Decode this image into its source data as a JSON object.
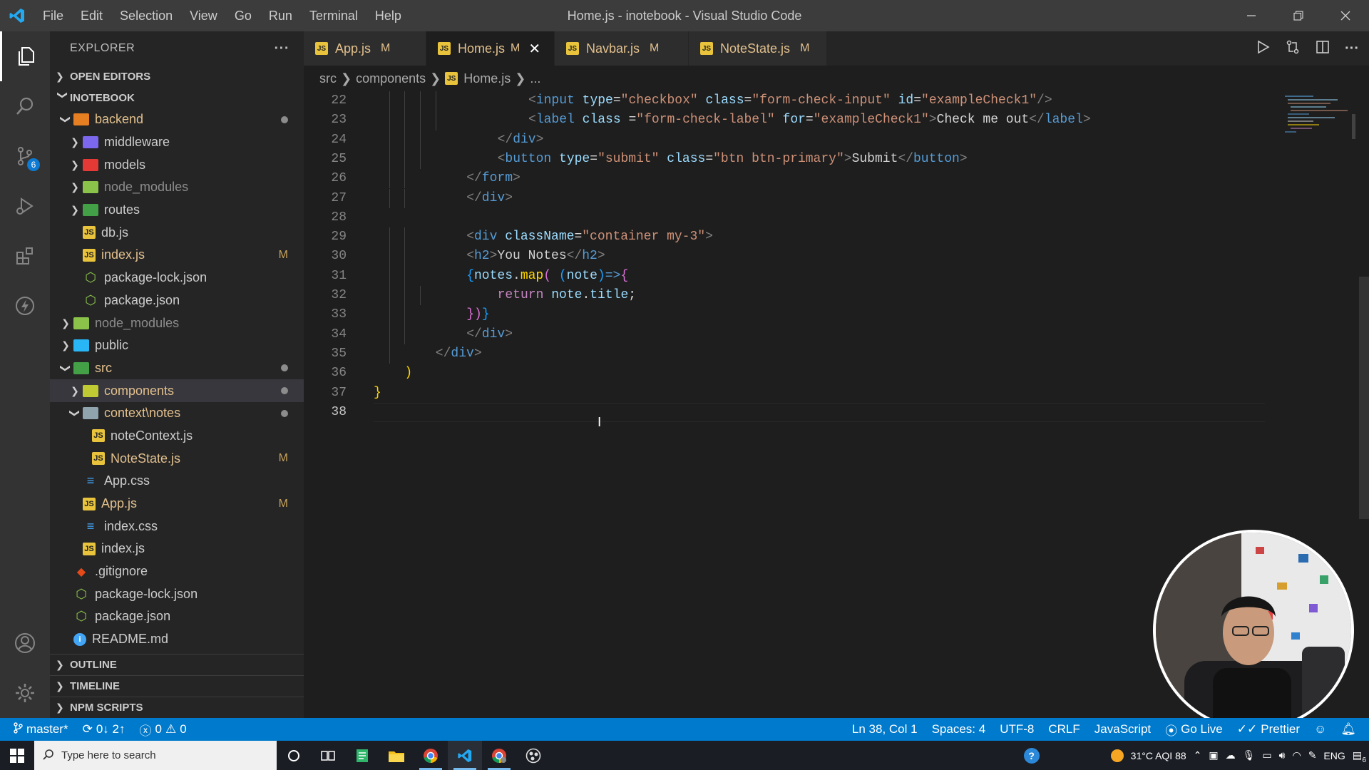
{
  "titlebar": {
    "menu": [
      "File",
      "Edit",
      "Selection",
      "View",
      "Go",
      "Run",
      "Terminal",
      "Help"
    ],
    "title": "Home.js - inotebook - Visual Studio Code"
  },
  "activitybar": {
    "icons": [
      "explorer-icon",
      "search-icon",
      "source-control-icon",
      "run-debug-icon",
      "extensions-icon",
      "thunder-client-icon",
      "account-icon",
      "settings-gear-icon"
    ],
    "source_control_badge": "6"
  },
  "sidebar": {
    "title": "EXPLORER",
    "more": "···",
    "open_editors": "OPEN EDITORS",
    "project": "INOTEBOOK",
    "tree": [
      {
        "label": "backend",
        "indent": 1,
        "kind": "folder",
        "open": true,
        "color": "mod",
        "flag": "dot",
        "icon_color": "#e67e22"
      },
      {
        "label": "middleware",
        "indent": 2,
        "kind": "folder",
        "open": false,
        "color": "norm",
        "icon_color": "#7b68ee"
      },
      {
        "label": "models",
        "indent": 2,
        "kind": "folder",
        "open": false,
        "color": "norm",
        "icon_color": "#e53935"
      },
      {
        "label": "node_modules",
        "indent": 2,
        "kind": "folder",
        "open": false,
        "color": "dim",
        "icon_color": "#8bc34a"
      },
      {
        "label": "routes",
        "indent": 2,
        "kind": "folder",
        "open": false,
        "color": "norm",
        "icon_color": "#43a047"
      },
      {
        "label": "db.js",
        "indent": 2,
        "kind": "js",
        "color": "norm"
      },
      {
        "label": "index.js",
        "indent": 2,
        "kind": "js",
        "color": "mod",
        "flag": "M"
      },
      {
        "label": "package-lock.json",
        "indent": 2,
        "kind": "npm",
        "color": "norm"
      },
      {
        "label": "package.json",
        "indent": 2,
        "kind": "npm",
        "color": "norm"
      },
      {
        "label": "node_modules",
        "indent": 1,
        "kind": "folder",
        "open": false,
        "color": "dim",
        "icon_color": "#8bc34a"
      },
      {
        "label": "public",
        "indent": 1,
        "kind": "folder",
        "open": false,
        "color": "norm",
        "icon_color": "#29b6f6"
      },
      {
        "label": "src",
        "indent": 1,
        "kind": "folder",
        "open": true,
        "color": "mod",
        "flag": "dot",
        "icon_color": "#43a047"
      },
      {
        "label": "components",
        "indent": 2,
        "kind": "folder",
        "open": false,
        "color": "mod",
        "flag": "dot",
        "selected": true,
        "icon_color": "#c0ca33"
      },
      {
        "label": "context\\notes",
        "indent": 2,
        "kind": "folder",
        "open": true,
        "color": "mod",
        "flag": "dot",
        "icon_color": "#90a4ae"
      },
      {
        "label": "noteContext.js",
        "indent": 3,
        "kind": "js",
        "color": "norm"
      },
      {
        "label": "NoteState.js",
        "indent": 3,
        "kind": "js",
        "color": "mod",
        "flag": "M"
      },
      {
        "label": "App.css",
        "indent": 2,
        "kind": "css",
        "color": "norm"
      },
      {
        "label": "App.js",
        "indent": 2,
        "kind": "js",
        "color": "mod",
        "flag": "M"
      },
      {
        "label": "index.css",
        "indent": 2,
        "kind": "css",
        "color": "norm"
      },
      {
        "label": "index.js",
        "indent": 2,
        "kind": "js",
        "color": "norm"
      },
      {
        "label": ".gitignore",
        "indent": 1,
        "kind": "git",
        "color": "norm"
      },
      {
        "label": "package-lock.json",
        "indent": 1,
        "kind": "npm",
        "color": "norm"
      },
      {
        "label": "package.json",
        "indent": 1,
        "kind": "npm",
        "color": "norm"
      },
      {
        "label": "README.md",
        "indent": 1,
        "kind": "info",
        "color": "norm"
      }
    ],
    "outline": "OUTLINE",
    "timeline": "TIMELINE",
    "npm_scripts": "NPM SCRIPTS"
  },
  "tabs": [
    {
      "label": "App.js",
      "flag": "M",
      "active": false
    },
    {
      "label": "Home.js",
      "flag": "M",
      "active": true
    },
    {
      "label": "Navbar.js",
      "flag": "M",
      "active": false
    },
    {
      "label": "NoteState.js",
      "flag": "M",
      "active": false
    }
  ],
  "breadcrumb": [
    "src",
    "components",
    "Home.js",
    "..."
  ],
  "editor": {
    "lines": [
      {
        "n": "22",
        "indent": 10,
        "tokens": [
          [
            "k-br",
            "<"
          ],
          [
            "k-tag",
            "input"
          ],
          [
            "k-txt",
            " "
          ],
          [
            "k-attr",
            "type"
          ],
          [
            "k-txt",
            "="
          ],
          [
            "k-str",
            "\"checkbox\""
          ],
          [
            "k-txt",
            " "
          ],
          [
            "k-attr",
            "class"
          ],
          [
            "k-txt",
            "="
          ],
          [
            "k-str",
            "\"form-check-input\""
          ],
          [
            "k-txt",
            " "
          ],
          [
            "k-attr",
            "id"
          ],
          [
            "k-txt",
            "="
          ],
          [
            "k-str",
            "\"exampleCheck1\""
          ],
          [
            "k-br",
            "/>"
          ]
        ]
      },
      {
        "n": "23",
        "indent": 10,
        "tokens": [
          [
            "k-br",
            "<"
          ],
          [
            "k-tag",
            "label"
          ],
          [
            "k-txt",
            " "
          ],
          [
            "k-attr",
            "class"
          ],
          [
            "k-txt",
            " ="
          ],
          [
            "k-str",
            "\"form-check-label\""
          ],
          [
            "k-txt",
            " "
          ],
          [
            "k-attr",
            "for"
          ],
          [
            "k-txt",
            "="
          ],
          [
            "k-str",
            "\"exampleCheck1\""
          ],
          [
            "k-br",
            ">"
          ],
          [
            "k-txt",
            "Check me out"
          ],
          [
            "k-br",
            "</"
          ],
          [
            "k-tag",
            "label"
          ],
          [
            "k-br",
            ">"
          ]
        ]
      },
      {
        "n": "24",
        "indent": 8,
        "tokens": [
          [
            "k-br",
            "</"
          ],
          [
            "k-tag",
            "div"
          ],
          [
            "k-br",
            ">"
          ]
        ]
      },
      {
        "n": "25",
        "indent": 8,
        "tokens": [
          [
            "k-br",
            "<"
          ],
          [
            "k-tag",
            "button"
          ],
          [
            "k-txt",
            " "
          ],
          [
            "k-attr",
            "type"
          ],
          [
            "k-txt",
            "="
          ],
          [
            "k-str",
            "\"submit\""
          ],
          [
            "k-txt",
            " "
          ],
          [
            "k-attr",
            "class"
          ],
          [
            "k-txt",
            "="
          ],
          [
            "k-str",
            "\"btn btn-primary\""
          ],
          [
            "k-br",
            ">"
          ],
          [
            "k-txt",
            "Submit"
          ],
          [
            "k-br",
            "</"
          ],
          [
            "k-tag",
            "button"
          ],
          [
            "k-br",
            ">"
          ]
        ]
      },
      {
        "n": "26",
        "indent": 6,
        "tokens": [
          [
            "k-br",
            "</"
          ],
          [
            "k-tag",
            "form"
          ],
          [
            "k-br",
            ">"
          ]
        ]
      },
      {
        "n": "27",
        "indent": 6,
        "tokens": [
          [
            "k-br",
            "</"
          ],
          [
            "k-tag",
            "div"
          ],
          [
            "k-br",
            ">"
          ]
        ]
      },
      {
        "n": "28",
        "indent": 0,
        "tokens": []
      },
      {
        "n": "29",
        "indent": 6,
        "tokens": [
          [
            "k-br",
            "<"
          ],
          [
            "k-tag",
            "div"
          ],
          [
            "k-txt",
            " "
          ],
          [
            "k-attr",
            "className"
          ],
          [
            "k-txt",
            "="
          ],
          [
            "k-str",
            "\"container my-3\""
          ],
          [
            "k-br",
            ">"
          ]
        ]
      },
      {
        "n": "30",
        "indent": 6,
        "tokens": [
          [
            "k-br",
            "<"
          ],
          [
            "k-tag",
            "h2"
          ],
          [
            "k-br",
            ">"
          ],
          [
            "k-txt",
            "You Notes"
          ],
          [
            "k-br",
            "</"
          ],
          [
            "k-tag",
            "h2"
          ],
          [
            "k-br",
            ">"
          ]
        ]
      },
      {
        "n": "31",
        "indent": 6,
        "tokens": [
          [
            "k-b",
            "{"
          ],
          [
            "k-attr",
            "notes"
          ],
          [
            "k-txt",
            "."
          ],
          [
            "k-y",
            "map"
          ],
          [
            "k-p",
            "("
          ],
          [
            "k-txt",
            " "
          ],
          [
            "k-b",
            "("
          ],
          [
            "k-attr",
            "note"
          ],
          [
            "k-b",
            ")"
          ],
          [
            "k-tag",
            "=>"
          ],
          [
            "k-p",
            "{"
          ]
        ]
      },
      {
        "n": "32",
        "indent": 8,
        "tokens": [
          [
            "k-kw",
            "return"
          ],
          [
            "k-txt",
            " "
          ],
          [
            "k-attr",
            "note"
          ],
          [
            "k-txt",
            "."
          ],
          [
            "k-attr",
            "title"
          ],
          [
            "k-txt",
            ";"
          ]
        ]
      },
      {
        "n": "33",
        "indent": 6,
        "tokens": [
          [
            "k-p",
            "}"
          ],
          [
            "k-p",
            ")"
          ],
          [
            "k-b",
            "}"
          ]
        ]
      },
      {
        "n": "34",
        "indent": 6,
        "tokens": [
          [
            "k-br",
            "</"
          ],
          [
            "k-tag",
            "div"
          ],
          [
            "k-br",
            ">"
          ]
        ]
      },
      {
        "n": "35",
        "indent": 4,
        "tokens": [
          [
            "k-br",
            "</"
          ],
          [
            "k-tag",
            "div"
          ],
          [
            "k-br",
            ">"
          ]
        ]
      },
      {
        "n": "36",
        "indent": 2,
        "tokens": [
          [
            "k-y",
            ")"
          ]
        ]
      },
      {
        "n": "37",
        "indent": 0,
        "tokens": [
          [
            "k-y",
            "}"
          ]
        ]
      },
      {
        "n": "38",
        "indent": 0,
        "tokens": [],
        "current": true
      }
    ]
  },
  "statusbar": {
    "branch": "master*",
    "sync": "0↓ 2↑",
    "errors": "0",
    "warnings": "0",
    "position": "Ln 38, Col 1",
    "spaces": "Spaces: 4",
    "encoding": "UTF-8",
    "eol": "CRLF",
    "language": "JavaScript",
    "golive": "Go Live",
    "prettier": "Prettier"
  },
  "taskbar": {
    "search_placeholder": "Type here to search",
    "weather": "31°C AQI 88",
    "lang": "ENG",
    "notif_count": "6"
  },
  "colors": {
    "accent": "#007acc",
    "modified": "#e2c08d"
  }
}
